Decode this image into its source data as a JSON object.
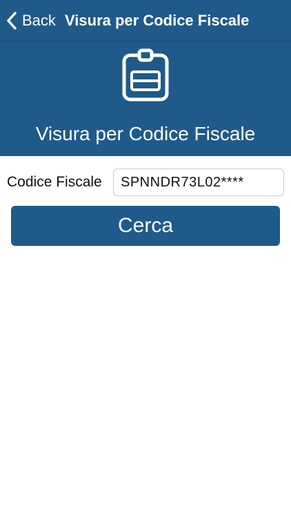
{
  "navbar": {
    "back_label": "Back",
    "title": "Visura per Codice Fiscale"
  },
  "hero": {
    "icon": "id-badge-icon",
    "title": "Visura per Codice Fiscale"
  },
  "form": {
    "codice_fiscale_label": "Codice Fiscale",
    "codice_fiscale_value": "SPNNDR73L02****"
  },
  "actions": {
    "search_label": "Cerca"
  },
  "colors": {
    "primary": "#1f5a8a",
    "text": "#111111",
    "background": "#ffffff"
  }
}
